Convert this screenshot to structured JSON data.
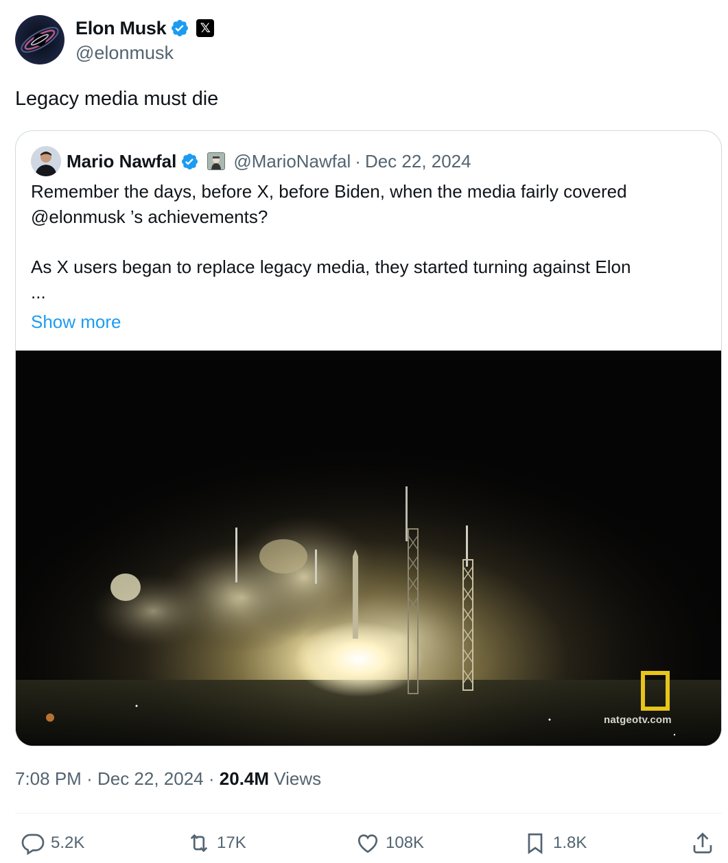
{
  "author": {
    "display_name": "Elon Musk",
    "handle": "@elonmusk",
    "verified_icon": "verified-badge-icon",
    "affiliation_icon": "x-logo-icon",
    "affiliation_glyph": "𝕏"
  },
  "tweet": {
    "text": "Legacy media must die"
  },
  "quoted": {
    "display_name": "Mario Nawfal",
    "handle": "@MarioNawfal",
    "separator": "·",
    "date": "Dec 22, 2024",
    "paragraph_1": "Remember the days, before X, before Biden, when the media fairly covered @elonmusk ’s achievements?",
    "paragraph_2": "As X users began to replace legacy media, they started turning against Elon",
    "ellipsis": "...",
    "show_more": "Show more",
    "media_watermark": "natgeotv.com"
  },
  "meta": {
    "time": "7:08 PM",
    "sep1": "·",
    "date": "Dec 22, 2024",
    "sep2": "·",
    "views_count": "20.4M",
    "views_label": "Views"
  },
  "actions": {
    "replies": "5.2K",
    "reposts": "17K",
    "likes": "108K",
    "bookmarks": "1.8K"
  },
  "colors": {
    "link": "#1d9bf0",
    "secondary_text": "#536471",
    "primary_text": "#0f1419",
    "border": "#cfd9de"
  }
}
